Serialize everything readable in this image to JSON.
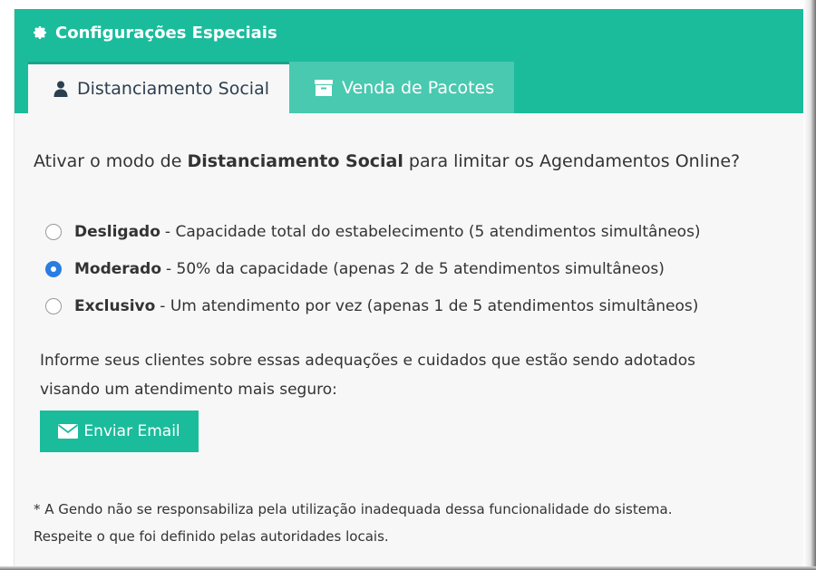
{
  "panel": {
    "title": "Configurações Especiais",
    "title_icon": "gear-icon"
  },
  "tabs": [
    {
      "label": "Distanciamento Social",
      "icon": "user-icon",
      "active": true
    },
    {
      "label": "Venda de Pacotes",
      "icon": "archive-icon",
      "active": false
    }
  ],
  "question": {
    "prefix": "Ativar o modo de ",
    "bold": "Distanciamento Social",
    "suffix": " para limitar os Agendamentos Online?"
  },
  "options": [
    {
      "label": "Desligado",
      "description": "- Capacidade total do estabelecimento (5 atendimentos simultâneos)",
      "selected": false
    },
    {
      "label": "Moderado",
      "description": "- 50% da capacidade (apenas 2 de 5 atendimentos simultâneos)",
      "selected": true
    },
    {
      "label": "Exclusivo",
      "description": "- Um atendimento por vez (apenas 1 de 5 atendimentos simultâneos)",
      "selected": false
    }
  ],
  "info": {
    "line1": "Informe seus clientes sobre essas adequações e cuidados que estão sendo adotados",
    "line2": "visando um atendimento mais seguro:"
  },
  "email_button": {
    "label": "Enviar Email",
    "icon": "envelope-icon"
  },
  "disclaimer": {
    "line1": "* A Gendo não se responsabiliza pela utilização inadequada dessa funcionalidade do sistema.",
    "line2": "Respeite o que foi definido pelas autoridades locais."
  },
  "colors": {
    "accent": "#1abc9c",
    "tab_inactive": "#48c9b0",
    "radio_selected": "#2a7de1",
    "panel_bg": "#f7f7f7"
  }
}
